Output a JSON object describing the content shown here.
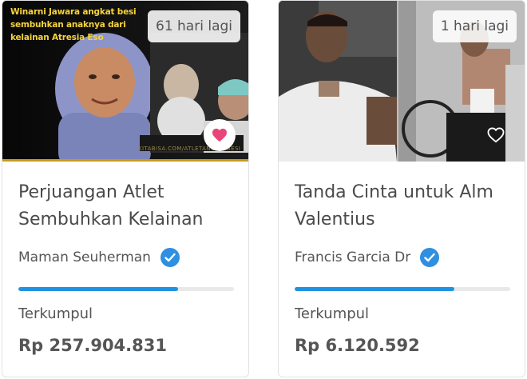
{
  "cards": [
    {
      "badge": "61 hari lagi",
      "banner_text": "Winarni Jawara angkat besi sembuhkan anaknya dari kelainan Atresia Eso",
      "web_text": "KITABISA.COM/ATLETANGKATBESI",
      "title": "Perjuangan Atlet Sembuhkan Kelainan",
      "author": "Maman Seuherman",
      "verified": true,
      "progress": 0.74,
      "collected_label": "Terkumpul",
      "collected_amount": "Rp 257.904.831",
      "favorited": true,
      "heart_color": "#e8457a"
    },
    {
      "badge": "1 hari lagi",
      "title": "Tanda Cinta untuk Alm Valentius",
      "author": "Francis Garcia Dr",
      "verified": true,
      "progress": 0.74,
      "collected_label": "Terkumpul",
      "collected_amount": "Rp 6.120.592",
      "favorited": false
    }
  ],
  "colors": {
    "accent": "#1f93e1",
    "verified": "#2f8fe0"
  }
}
